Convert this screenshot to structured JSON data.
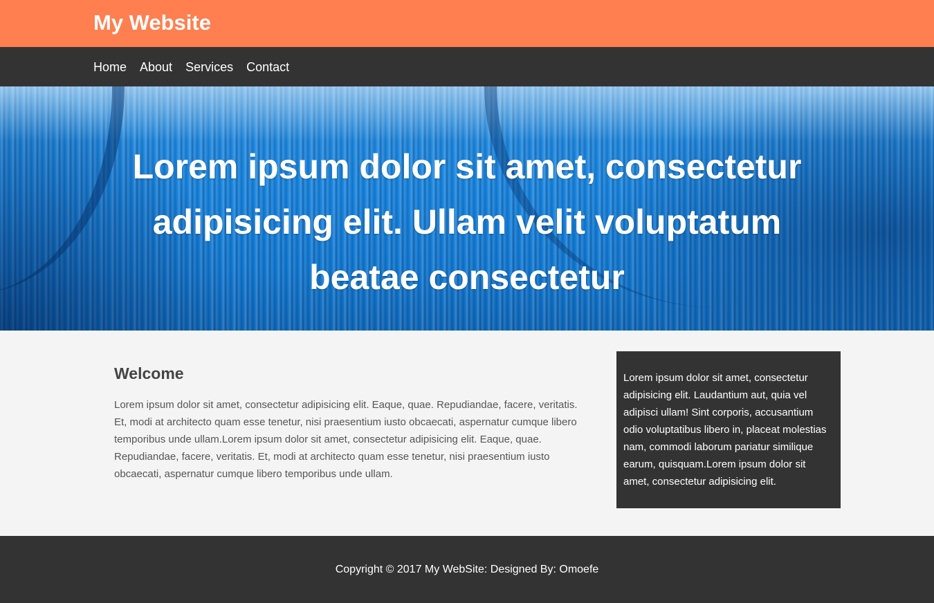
{
  "header": {
    "title": "My Website",
    "colors": {
      "background": "#ff7f50",
      "text": "#ffffff"
    }
  },
  "nav": {
    "items": [
      {
        "label": "Home"
      },
      {
        "label": "About"
      },
      {
        "label": "Services"
      },
      {
        "label": "Contact"
      }
    ],
    "colors": {
      "background": "#333333",
      "text": "#ffffff"
    }
  },
  "hero": {
    "text": "Lorem ipsum dolor sit amet, consectetur adipisicing elit. Ullam velit voluptatum beatae consectetur",
    "background": "blue stage curtains",
    "colors": {
      "curtain": "#1a86e0",
      "text": "#ffffff"
    }
  },
  "main": {
    "heading": "Welcome",
    "body": "Lorem ipsum dolor sit amet, consectetur adipisicing elit. Eaque, quae. Repudiandae, facere, veritatis. Et, modi at architecto quam esse tenetur, nisi praesentium iusto obcaecati, aspernatur cumque libero temporibus unde ullam.Lorem ipsum dolor sit amet, consectetur adipisicing elit. Eaque, quae. Repudiandae, facere, veritatis. Et, modi at architecto quam esse tenetur, nisi praesentium iusto obcaecati, aspernatur cumque libero temporibus unde ullam."
  },
  "sidebar": {
    "text": "Lorem ipsum dolor sit amet, consectetur adipisicing elit. Laudantium aut, quia vel adipisci ullam! Sint corporis, accusantium odio voluptatibus libero in, placeat molestias nam, commodi laborum pariatur similique earum, quisquam.Lorem ipsum dolor sit amet, consectetur adipisicing elit.",
    "colors": {
      "background": "#333333",
      "text": "#ffffff"
    }
  },
  "footer": {
    "text": "Copyright © 2017 My WebSite: Designed By: Omoefe",
    "colors": {
      "background": "#333333",
      "text": "#ffffff"
    }
  },
  "page": {
    "colors": {
      "background": "#f4f4f4",
      "heading": "#444444",
      "body_text": "#555555"
    }
  }
}
